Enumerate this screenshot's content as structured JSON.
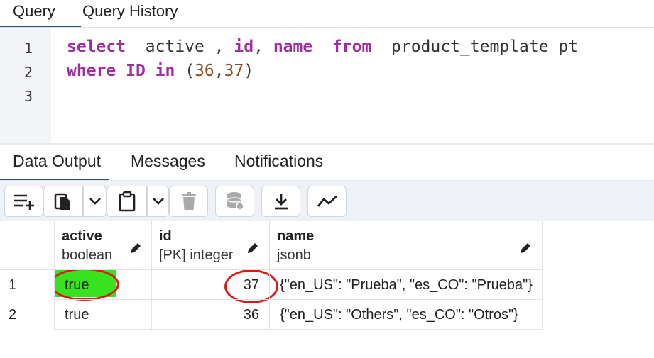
{
  "query_tabs": [
    {
      "label": "Query"
    },
    {
      "label": "Query History"
    }
  ],
  "editor": {
    "line_numbers": [
      "1",
      "2",
      "3"
    ],
    "line1": {
      "kw_select": "select",
      "t1": "  active , ",
      "kw_id": "id",
      "t2": ", ",
      "kw_name": "name",
      "t3": "  ",
      "kw_from": "from",
      "t4": "  product_template pt"
    },
    "line2": {
      "kw_where": "where",
      "t1": " ",
      "kw_ID": "ID",
      "t2": " ",
      "kw_in": "in",
      "t3": " (",
      "n1": "36",
      "t4": ",",
      "n2": "37",
      "t5": ")"
    }
  },
  "output_tabs": [
    {
      "label": "Data Output"
    },
    {
      "label": "Messages"
    },
    {
      "label": "Notifications"
    }
  ],
  "toolbar": {
    "buttons": [
      {
        "icon": "add-row-icon"
      },
      {
        "icon": "copy-icon"
      },
      {
        "icon": "chevron-down-icon"
      },
      {
        "icon": "paste-icon"
      },
      {
        "icon": "chevron-down-icon"
      },
      {
        "icon": "delete-icon"
      },
      {
        "icon": "save-data-icon"
      },
      {
        "icon": "download-icon"
      },
      {
        "icon": "graph-icon"
      }
    ]
  },
  "grid": {
    "columns": [
      {
        "name": "active",
        "type": "boolean"
      },
      {
        "name": "id",
        "type": "[PK] integer"
      },
      {
        "name": "name",
        "type": "jsonb"
      }
    ],
    "rows": [
      {
        "num": "1",
        "active": "true",
        "id": "37",
        "name": "{\"en_US\": \"Prueba\", \"es_CO\": \"Prueba\"}"
      },
      {
        "num": "2",
        "active": "true",
        "id": "36",
        "name": "{\"en_US\": \"Others\", \"es_CO\": \"Otros\"}"
      }
    ]
  },
  "colors": {
    "highlight": "#37e21e",
    "annotation": "#e01717",
    "keyword": "#a12ba3",
    "accent": "#2c4b73"
  }
}
